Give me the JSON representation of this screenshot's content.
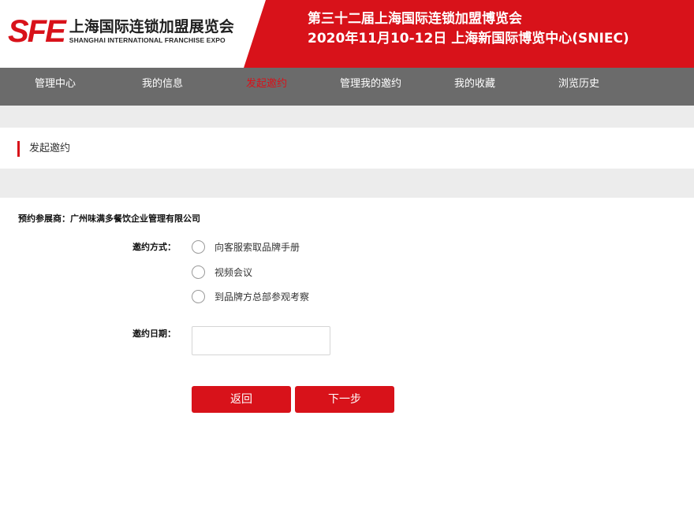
{
  "header": {
    "logo_mark": "SFE",
    "logo_cn": "上海国际连锁加盟展览会",
    "logo_en": "SHANGHAI INTERNATIONAL FRANCHISE EXPO",
    "event_line1": "第三十二届上海国际连锁加盟博览会",
    "event_line2": "2020年11月10-12日 上海新国际博览中心(SNIEC)",
    "accent_color": "#d8121a"
  },
  "nav": {
    "items": [
      {
        "label": "管理中心"
      },
      {
        "label": "我的信息"
      },
      {
        "label": "发起邀约",
        "active": true
      },
      {
        "label": "管理我的邀约"
      },
      {
        "label": "我的收藏"
      },
      {
        "label": "浏览历史"
      }
    ]
  },
  "section": {
    "title": "发起邀约"
  },
  "form": {
    "exhibitor_text": "预约参展商：广州味满多餐饮企业管理有限公司",
    "method_label": "邀约方式：",
    "methods": [
      {
        "label": "向客服索取品牌手册",
        "selected": false
      },
      {
        "label": "视频会议",
        "selected": false
      },
      {
        "label": "到品牌方总部参观考察",
        "selected": false
      }
    ],
    "date_label": "邀约日期：",
    "date_value": "",
    "back_label": "返回",
    "next_label": "下一步"
  }
}
